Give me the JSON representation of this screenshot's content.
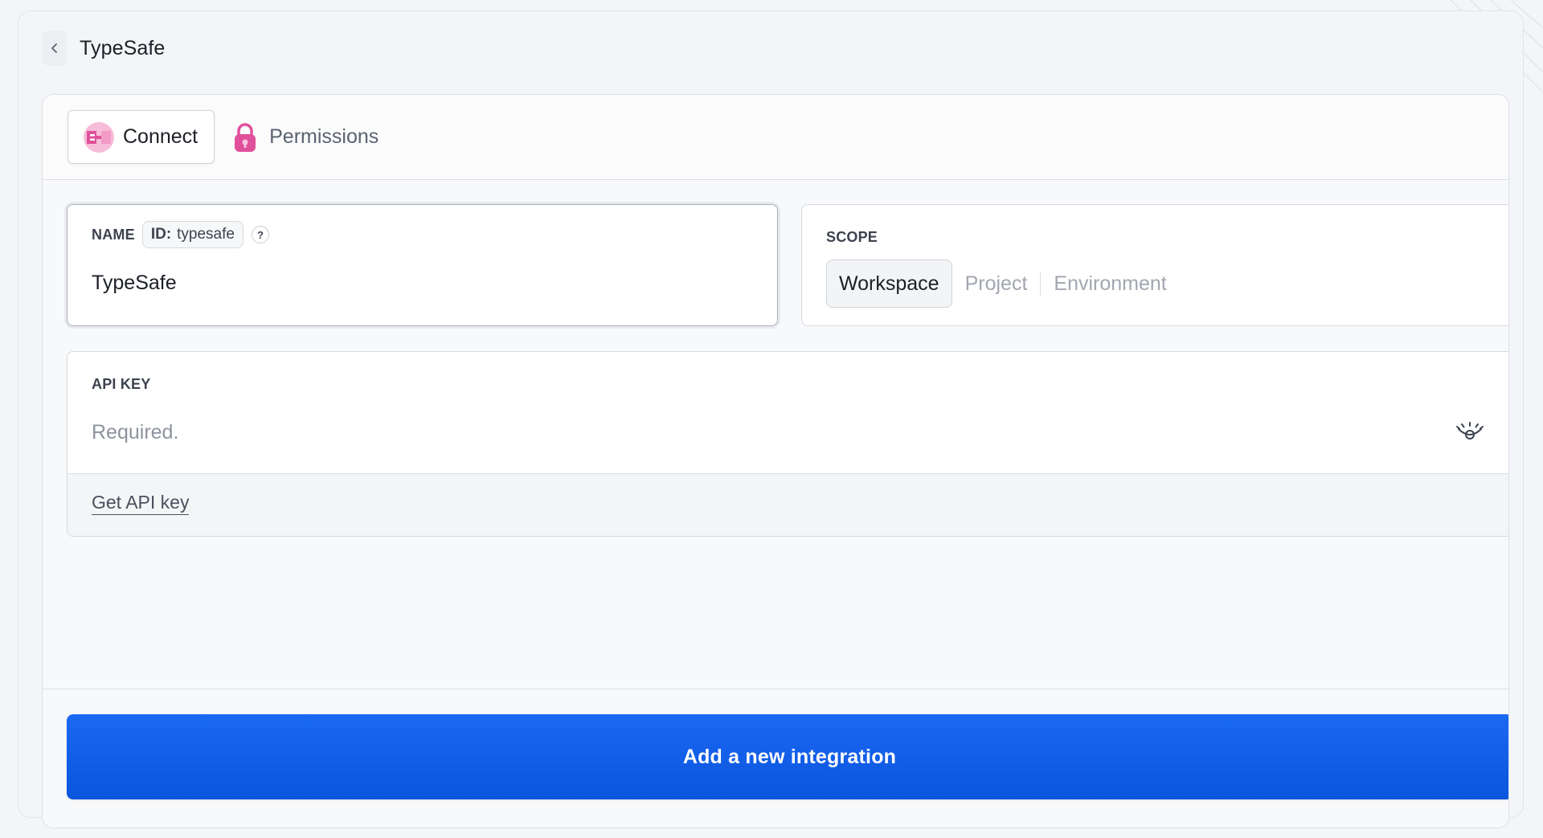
{
  "header": {
    "title": "TypeSafe"
  },
  "tabs": [
    {
      "label": "Connect",
      "icon": "plug-connect-icon",
      "active": true
    },
    {
      "label": "Permissions",
      "icon": "lock-icon",
      "active": false
    }
  ],
  "name_field": {
    "label": "NAME",
    "id_key": "ID:",
    "id_value": "typesafe",
    "help": "?",
    "value": "TypeSafe"
  },
  "scope_field": {
    "label": "SCOPE",
    "options": [
      "Workspace",
      "Project",
      "Environment"
    ],
    "selected": "Workspace"
  },
  "api_key_field": {
    "label": "API KEY",
    "placeholder": "Required.",
    "value": "",
    "toggle_icon": "eye-icon",
    "link": "Get API key"
  },
  "submit": {
    "label": "Add a new integration"
  },
  "colors": {
    "accent": "#0d5ae4",
    "brand_pink": "#e0509a"
  }
}
